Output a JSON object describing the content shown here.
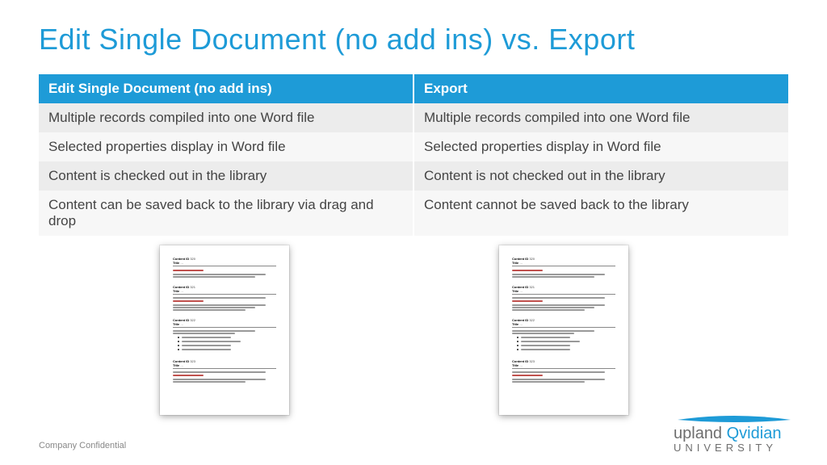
{
  "title": "Edit Single Document (no add ins) vs. Export",
  "table": {
    "headers": [
      "Edit Single Document (no add ins)",
      "Export"
    ],
    "rows": [
      [
        "Multiple records compiled into one Word file",
        "Multiple records compiled into one Word file"
      ],
      [
        "Selected properties display in Word file",
        "Selected properties display in Word file"
      ],
      [
        "Content is checked out in the library",
        "Content is not checked out in the library"
      ],
      [
        "Content can be saved back to the library via drag and drop",
        "Content cannot be saved back to the library"
      ]
    ]
  },
  "footer": "Company Confidential",
  "brand": {
    "word1": "upland",
    "word2": "Qvidian",
    "sub": "UNIVERSITY"
  }
}
